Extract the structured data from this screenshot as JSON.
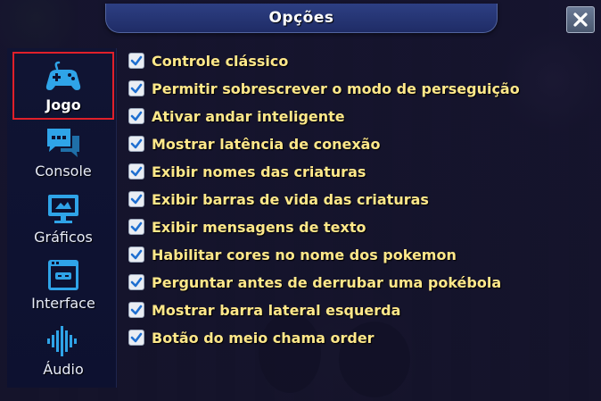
{
  "window": {
    "title": "Opções"
  },
  "colors": {
    "accent": "#ffe88a",
    "active_border": "#e0202a",
    "icon_blue": "#2fa4e8"
  },
  "sidebar": {
    "items": [
      {
        "label": "Jogo",
        "icon": "gamepad-icon",
        "active": true
      },
      {
        "label": "Console",
        "icon": "chat-bubbles-icon",
        "active": false
      },
      {
        "label": "Gráficos",
        "icon": "monitor-icon",
        "active": false
      },
      {
        "label": "Interface",
        "icon": "window-icon",
        "active": false
      },
      {
        "label": "Áudio",
        "icon": "sound-wave-icon",
        "active": false
      }
    ]
  },
  "options": [
    {
      "label": "Controle clássico",
      "checked": true
    },
    {
      "label": "Permitir sobrescrever o modo de perseguição",
      "checked": true
    },
    {
      "label": "Ativar andar inteligente",
      "checked": true
    },
    {
      "label": "Mostrar latência de conexão",
      "checked": true
    },
    {
      "label": "Exibir nomes das criaturas",
      "checked": true
    },
    {
      "label": "Exibir barras de vida das criaturas",
      "checked": true
    },
    {
      "label": "Exibir mensagens de texto",
      "checked": true
    },
    {
      "label": "Habilitar cores no nome dos pokemon",
      "checked": true
    },
    {
      "label": "Perguntar antes de derrubar uma pokébola",
      "checked": true
    },
    {
      "label": "Mostrar barra lateral esquerda",
      "checked": true
    },
    {
      "label": "Botão do meio chama order",
      "checked": true
    }
  ]
}
